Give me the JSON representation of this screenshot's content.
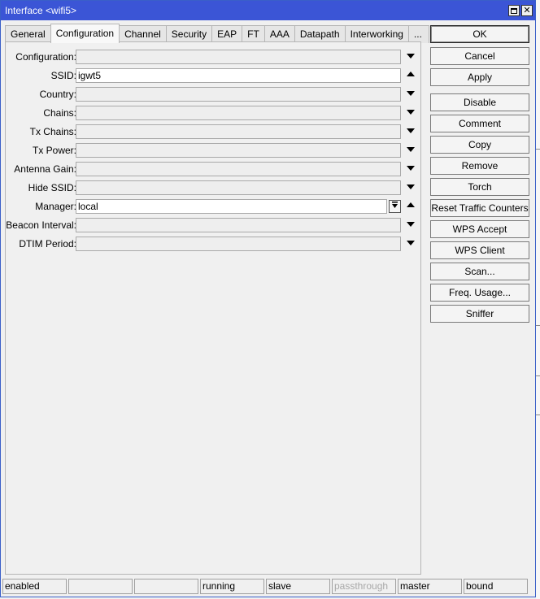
{
  "window": {
    "title": "Interface <wifi5>"
  },
  "tabs": [
    {
      "label": "General",
      "active": false
    },
    {
      "label": "Configuration",
      "active": true
    },
    {
      "label": "Channel",
      "active": false
    },
    {
      "label": "Security",
      "active": false
    },
    {
      "label": "EAP",
      "active": false
    },
    {
      "label": "FT",
      "active": false
    },
    {
      "label": "AAA",
      "active": false
    },
    {
      "label": "Datapath",
      "active": false
    },
    {
      "label": "Interworking",
      "active": false
    },
    {
      "label": "...",
      "active": false
    }
  ],
  "fields": [
    {
      "label": "Configuration:",
      "value": "",
      "arrow": "down"
    },
    {
      "label": "SSID:",
      "value": "igwt5",
      "arrow": "up"
    },
    {
      "label": "Country:",
      "value": "",
      "arrow": "down"
    },
    {
      "label": "Chains:",
      "value": "",
      "arrow": "down"
    },
    {
      "label": "Tx Chains:",
      "value": "",
      "arrow": "down"
    },
    {
      "label": "Tx Power:",
      "value": "",
      "arrow": "down"
    },
    {
      "label": "Antenna Gain:",
      "value": "",
      "arrow": "down"
    },
    {
      "label": "Hide SSID:",
      "value": "",
      "arrow": "down"
    },
    {
      "label": "Manager:",
      "value": "local",
      "arrow": "up"
    },
    {
      "label": "Beacon Interval:",
      "value": "",
      "arrow": "down"
    },
    {
      "label": "DTIM Period:",
      "value": "",
      "arrow": "down"
    }
  ],
  "manager_dropdown_icon": "dropdown-icon",
  "buttons": [
    {
      "label": "OK"
    },
    {
      "label": "Cancel"
    },
    {
      "label": "Apply"
    },
    {
      "label": "Disable"
    },
    {
      "label": "Comment"
    },
    {
      "label": "Copy"
    },
    {
      "label": "Remove"
    },
    {
      "label": "Torch"
    },
    {
      "label": "Reset Traffic Counters"
    },
    {
      "label": "WPS Accept"
    },
    {
      "label": "WPS Client"
    },
    {
      "label": "Scan..."
    },
    {
      "label": "Freq. Usage..."
    },
    {
      "label": "Sniffer"
    }
  ],
  "status": [
    {
      "text": "enabled",
      "dim": false
    },
    {
      "text": "",
      "dim": false
    },
    {
      "text": "",
      "dim": false
    },
    {
      "text": "running",
      "dim": false
    },
    {
      "text": "slave",
      "dim": false
    },
    {
      "text": "passthrough",
      "dim": true
    },
    {
      "text": "master",
      "dim": false
    },
    {
      "text": "bound",
      "dim": false
    }
  ],
  "colors": {
    "titlebar": "#3b55d6",
    "window_bg": "#f0f0f0"
  }
}
